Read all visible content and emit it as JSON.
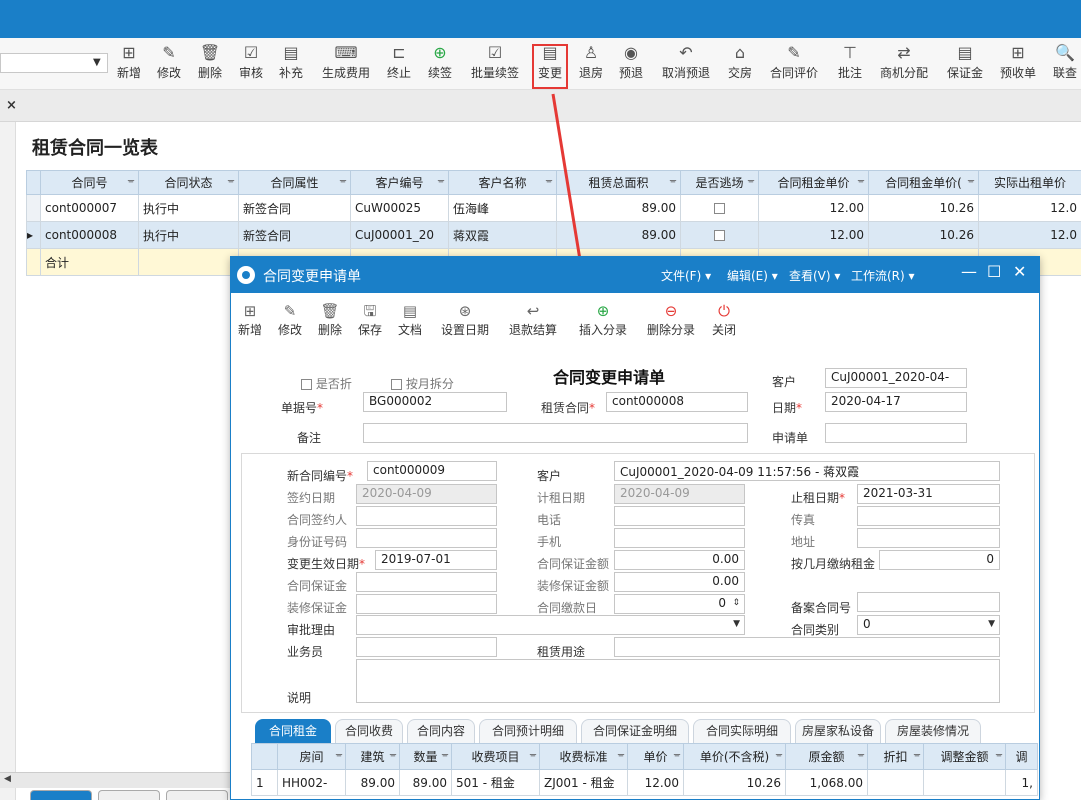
{
  "toolbar": {
    "items": [
      {
        "label": "新增",
        "icon": "add-icon"
      },
      {
        "label": "修改",
        "icon": "edit-icon"
      },
      {
        "label": "删除",
        "icon": "trash-icon"
      },
      {
        "label": "审核",
        "icon": "check-icon"
      },
      {
        "label": "补充",
        "icon": "document-icon"
      },
      {
        "label": "生成费用",
        "icon": "keyboard-icon"
      },
      {
        "label": "终止",
        "icon": "stop-icon"
      },
      {
        "label": "续签",
        "icon": "renew-icon"
      },
      {
        "label": "批量续签",
        "icon": "batch-icon"
      },
      {
        "label": "变更",
        "icon": "change-icon"
      },
      {
        "label": "退房",
        "icon": "person-icon"
      },
      {
        "label": "预退",
        "icon": "eye-icon"
      },
      {
        "label": "取消预退",
        "icon": "undo-icon"
      },
      {
        "label": "交房",
        "icon": "house-icon"
      },
      {
        "label": "合同评价",
        "icon": "rate-icon"
      },
      {
        "label": "批注",
        "icon": "note-icon"
      },
      {
        "label": "商机分配",
        "icon": "transfer-icon"
      },
      {
        "label": "保证金",
        "icon": "deposit-icon"
      },
      {
        "label": "预收单",
        "icon": "receipt-icon"
      },
      {
        "label": "联查",
        "icon": "search-icon"
      }
    ]
  },
  "list": {
    "title": "租赁合同一览表",
    "columns": [
      "合同号",
      "合同状态",
      "合同属性",
      "客户编号",
      "客户名称",
      "租赁总面积",
      "是否逃场",
      "合同租金单价",
      "合同租金单价(",
      "实际出租单价"
    ],
    "rows": [
      {
        "contract_no": "cont000007",
        "status": "执行中",
        "attr": "新签合同",
        "cust_no": "CuW00025",
        "cust_name": "伍海峰",
        "area": "89.00",
        "price": "12.00",
        "price2": "10.26",
        "actual": "12.0"
      },
      {
        "contract_no": "cont000008",
        "status": "执行中",
        "attr": "新签合同",
        "cust_no": "CuJ00001_20",
        "cust_name": "蒋双霞",
        "area": "89.00",
        "price": "12.00",
        "price2": "10.26",
        "actual": "12.0"
      }
    ],
    "total_label": "合计"
  },
  "dialog": {
    "title": "合同变更申请单",
    "menus": [
      "文件(F)",
      "编辑(E)",
      "查看(V)",
      "工作流(R)"
    ],
    "toolbar": [
      {
        "label": "新增",
        "icon": "add-icon"
      },
      {
        "label": "修改",
        "icon": "edit-icon"
      },
      {
        "label": "删除",
        "icon": "trash-icon"
      },
      {
        "label": "保存",
        "icon": "save-icon"
      },
      {
        "label": "文档",
        "icon": "document-icon"
      },
      {
        "label": "设置日期",
        "icon": "calendar-icon"
      },
      {
        "label": "退款结算",
        "icon": "back-icon"
      },
      {
        "label": "插入分录",
        "icon": "plus-circle-icon"
      },
      {
        "label": "删除分录",
        "icon": "minus-circle-icon"
      },
      {
        "label": "关闭",
        "icon": "power-icon"
      }
    ],
    "form_title": "合同变更申请单",
    "is_split_label": "是否折",
    "monthly_split_label": "按月拆分",
    "customer_label": "客户",
    "customer_value": "CuJ00001_2020-04-",
    "doc_no_label": "单据号",
    "doc_no_value": "BG000002",
    "lease_contract_label": "租赁合同",
    "lease_contract_value": "cont000008",
    "date_label": "日期",
    "date_value": "2020-04-17",
    "remark_label": "备注",
    "remark_value": "",
    "applicant_label": "申请单",
    "applicant_value": "",
    "fields": {
      "new_contract_no_label": "新合同编号",
      "new_contract_no": "cont000009",
      "customer2_label": "客户",
      "customer2": "CuJ00001_2020-04-09 11:57:56 - 蒋双霞",
      "sign_date_label": "签约日期",
      "sign_date": "2020-04-09",
      "rent_start_label": "计租日期",
      "rent_start": "2020-04-09",
      "rent_end_label": "止租日期",
      "rent_end": "2021-03-31",
      "signer_label": "合同签约人",
      "phone_label": "电话",
      "fax_label": "传真",
      "id_label": "身份证号码",
      "mobile_label": "手机",
      "address_label": "地址",
      "effective_label": "变更生效日期",
      "effective": "2019-07-01",
      "contract_deposit_amt_label": "合同保证金额",
      "contract_deposit_amt": "0.00",
      "months_per_pay_label": "按几月缴纳租金",
      "months_per_pay": "0",
      "contract_deposit_label": "合同保证金",
      "reno_deposit_amt_label": "装修保证金额",
      "reno_deposit_amt": "0.00",
      "reno_deposit_label": "装修保证金",
      "pay_day_label": "合同缴款日",
      "pay_day": "0",
      "filing_no_label": "备案合同号",
      "approve_reason_label": "审批理由",
      "contract_type_label": "合同类别",
      "contract_type": "0",
      "salesman_label": "业务员",
      "usage_label": "租赁用途",
      "desc_label": "说明"
    },
    "tabs": [
      "合同租金",
      "合同收费",
      "合同内容",
      "合同预计明细",
      "合同保证金明细",
      "合同实际明细",
      "房屋家私设备",
      "房屋装修情况"
    ],
    "detail": {
      "columns": [
        "",
        "房间",
        "建筑",
        "数量",
        "收费项目",
        "收费标准",
        "单价",
        "单价(不含税)",
        "原金额",
        "折扣",
        "调整金额",
        "调"
      ],
      "rows": [
        {
          "idx": "1",
          "room": "HH002-",
          "build": "89.00",
          "qty": "89.00",
          "item": "501 - 租金",
          "std": "ZJ001 - 租金",
          "price": "12.00",
          "price_ex": "10.26",
          "orig": "1,068.00",
          "disc": "",
          "adj": "",
          "adj2": "1,"
        }
      ]
    }
  }
}
